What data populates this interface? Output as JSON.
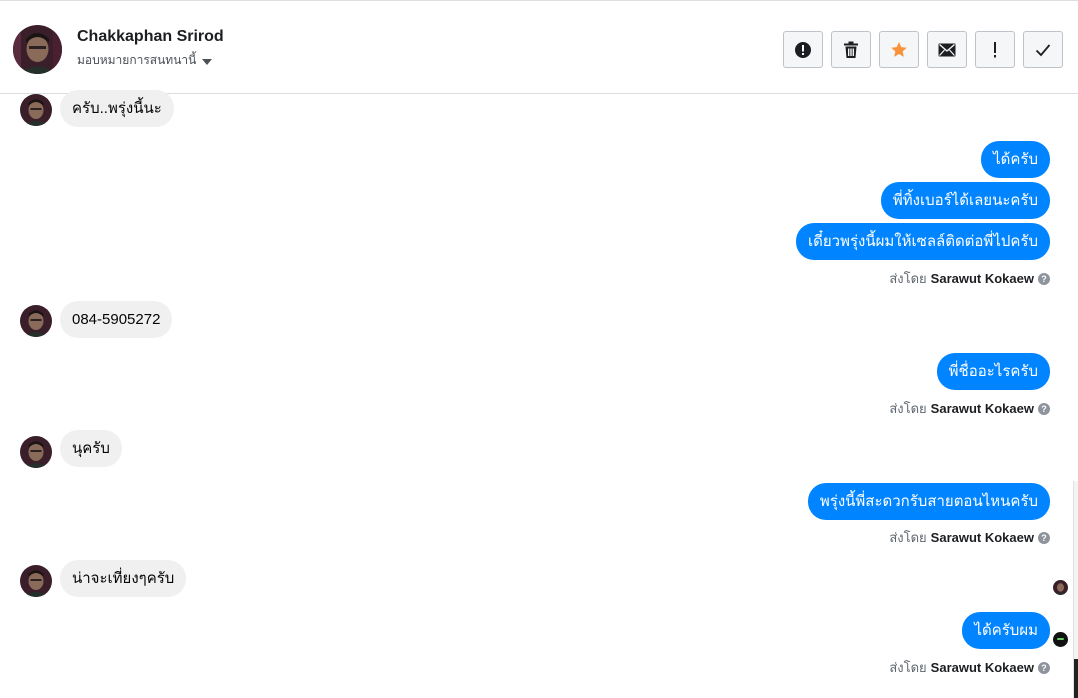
{
  "header": {
    "contact_name": "Chakkaphan Srirod",
    "assign_label": "มอบหมายการสนทนานี้"
  },
  "actions": [
    {
      "name": "mark-spam-button",
      "icon": "alert-circle-icon"
    },
    {
      "name": "delete-button",
      "icon": "trash-icon"
    },
    {
      "name": "star-button",
      "icon": "star-icon",
      "color": "#f7923b"
    },
    {
      "name": "mark-unread-button",
      "icon": "envelope-icon"
    },
    {
      "name": "follow-up-button",
      "icon": "exclamation-icon"
    },
    {
      "name": "mark-done-button",
      "icon": "check-icon"
    }
  ],
  "messages": {
    "m1": "ครับ..พรุ่งนี้นะ",
    "m2": "ได้ครับ",
    "m3": "พี่ทิ้งเบอร์ได้เลยนะครับ",
    "m4": "เดี๋ยวพรุ่งนี้ผมให้เซลล์ติดต่อพี่ไปครับ",
    "m5": "084-5905272",
    "m6": "พี่ชื่ออะไรครับ",
    "m7": "นุครับ",
    "m8": "พรุ่งนี้พี่สะดวกรับสายตอนไหนครับ",
    "m9": "น่าจะเที่ยงๆครับ",
    "m10": "ได้ครับผม"
  },
  "sent_by": {
    "prefix": "ส่งโดย",
    "agent": "Sarawut Kokaew",
    "help": "?"
  },
  "colors": {
    "outgoing_bubble": "#0084ff",
    "incoming_bubble": "#f0f0f0"
  }
}
